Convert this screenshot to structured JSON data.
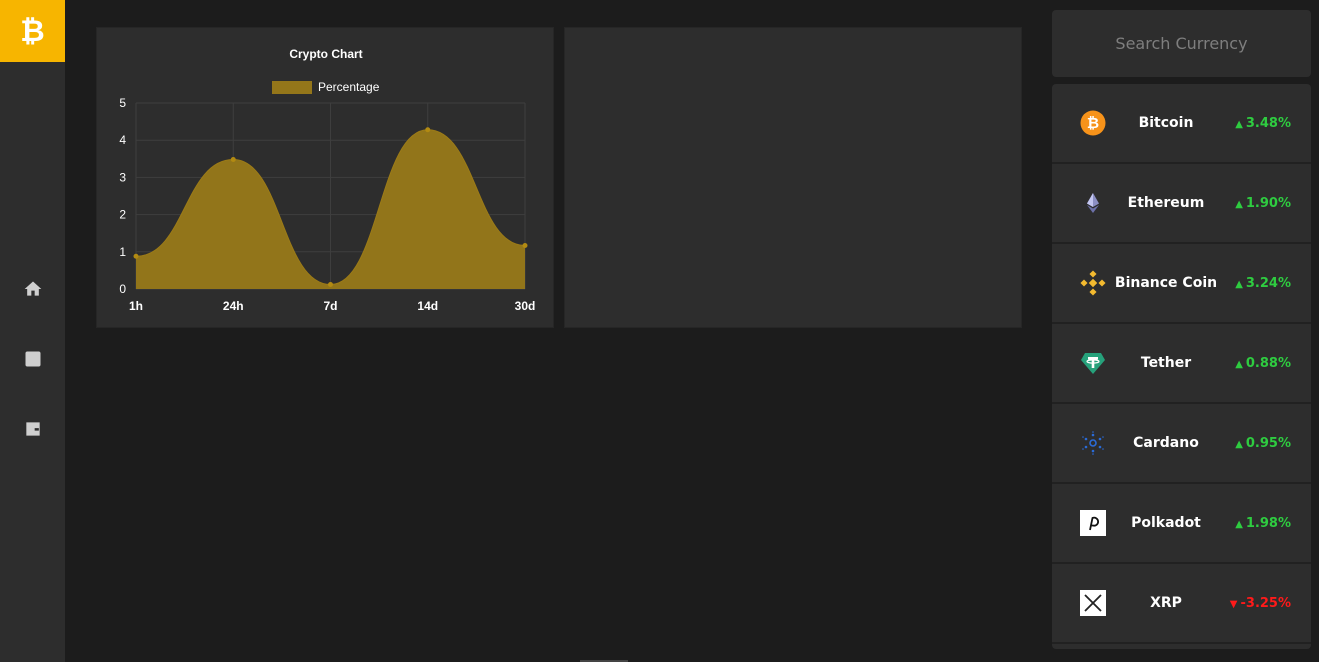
{
  "sidebar": {
    "logo": "₿",
    "items": [
      {
        "icon": "home-icon"
      },
      {
        "icon": "chart-icon"
      },
      {
        "icon": "wallet-icon"
      }
    ]
  },
  "colors": {
    "accent": "#f7b500",
    "chart_fill": "#94761a",
    "positive": "#2ecc40",
    "negative": "#ff1a1a"
  },
  "search": {
    "placeholder": "Search Currency"
  },
  "chart_data": {
    "type": "area",
    "title": "Crypto Chart",
    "categories": [
      "1h",
      "24h",
      "7d",
      "14d",
      "30d"
    ],
    "series": [
      {
        "name": "Percentage",
        "values": [
          0.88,
          3.48,
          0.12,
          4.28,
          1.17
        ]
      }
    ],
    "ylim": [
      0,
      5
    ],
    "yticks": [
      "0",
      "1",
      "2",
      "3",
      "4",
      "5"
    ],
    "grid": true,
    "legend": "top"
  },
  "coins": [
    {
      "name": "Bitcoin",
      "change": "3.48%",
      "direction": "up",
      "icon": "bitcoin-icon"
    },
    {
      "name": "Ethereum",
      "change": "1.90%",
      "direction": "up",
      "icon": "ethereum-icon"
    },
    {
      "name": "Binance Coin",
      "change": "3.24%",
      "direction": "up",
      "icon": "binance-coin-icon"
    },
    {
      "name": "Tether",
      "change": "0.88%",
      "direction": "up",
      "icon": "tether-icon"
    },
    {
      "name": "Cardano",
      "change": "0.95%",
      "direction": "up",
      "icon": "cardano-icon"
    },
    {
      "name": "Polkadot",
      "change": "1.98%",
      "direction": "up",
      "icon": "polkadot-icon"
    },
    {
      "name": "XRP",
      "change": "-3.25%",
      "direction": "down",
      "icon": "xrp-icon"
    }
  ]
}
